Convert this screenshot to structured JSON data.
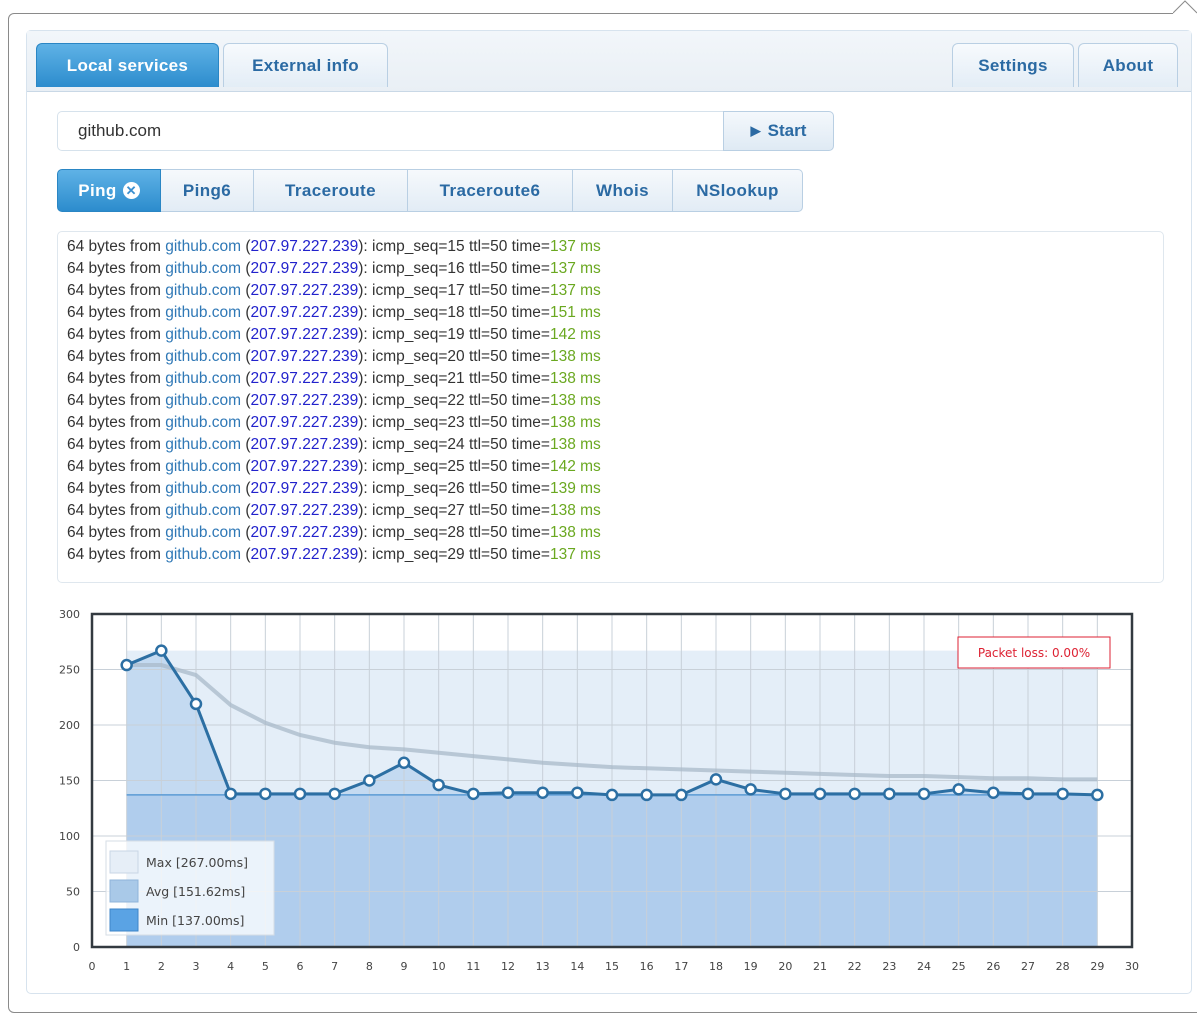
{
  "main_tabs": [
    {
      "label": "Local services",
      "active": true
    },
    {
      "label": "External info",
      "active": false
    }
  ],
  "right_tabs": [
    {
      "label": "Settings"
    },
    {
      "label": "About"
    }
  ],
  "search": {
    "value": "github.com",
    "start_label": "Start"
  },
  "tool_tabs": [
    {
      "label": "Ping",
      "active": true,
      "closable": true
    },
    {
      "label": "Ping6"
    },
    {
      "label": "Traceroute"
    },
    {
      "label": "Traceroute6"
    },
    {
      "label": "Whois"
    },
    {
      "label": "NSlookup"
    }
  ],
  "output": {
    "lines": [
      {
        "prefix": "64 bytes from ",
        "host": "github.com",
        "ip": "207.97.227.239",
        "mid": "): icmp_seq=15 ttl=50 time=",
        "time": "137 ms"
      },
      {
        "prefix": "64 bytes from ",
        "host": "github.com",
        "ip": "207.97.227.239",
        "mid": "): icmp_seq=16 ttl=50 time=",
        "time": "137 ms"
      },
      {
        "prefix": "64 bytes from ",
        "host": "github.com",
        "ip": "207.97.227.239",
        "mid": "): icmp_seq=17 ttl=50 time=",
        "time": "137 ms"
      },
      {
        "prefix": "64 bytes from ",
        "host": "github.com",
        "ip": "207.97.227.239",
        "mid": "): icmp_seq=18 ttl=50 time=",
        "time": "151 ms"
      },
      {
        "prefix": "64 bytes from ",
        "host": "github.com",
        "ip": "207.97.227.239",
        "mid": "): icmp_seq=19 ttl=50 time=",
        "time": "142 ms"
      },
      {
        "prefix": "64 bytes from ",
        "host": "github.com",
        "ip": "207.97.227.239",
        "mid": "): icmp_seq=20 ttl=50 time=",
        "time": "138 ms"
      },
      {
        "prefix": "64 bytes from ",
        "host": "github.com",
        "ip": "207.97.227.239",
        "mid": "): icmp_seq=21 ttl=50 time=",
        "time": "138 ms"
      },
      {
        "prefix": "64 bytes from ",
        "host": "github.com",
        "ip": "207.97.227.239",
        "mid": "): icmp_seq=22 ttl=50 time=",
        "time": "138 ms"
      },
      {
        "prefix": "64 bytes from ",
        "host": "github.com",
        "ip": "207.97.227.239",
        "mid": "): icmp_seq=23 ttl=50 time=",
        "time": "138 ms"
      },
      {
        "prefix": "64 bytes from ",
        "host": "github.com",
        "ip": "207.97.227.239",
        "mid": "): icmp_seq=24 ttl=50 time=",
        "time": "138 ms"
      },
      {
        "prefix": "64 bytes from ",
        "host": "github.com",
        "ip": "207.97.227.239",
        "mid": "): icmp_seq=25 ttl=50 time=",
        "time": "142 ms"
      },
      {
        "prefix": "64 bytes from ",
        "host": "github.com",
        "ip": "207.97.227.239",
        "mid": "): icmp_seq=26 ttl=50 time=",
        "time": "139 ms"
      },
      {
        "prefix": "64 bytes from ",
        "host": "github.com",
        "ip": "207.97.227.239",
        "mid": "): icmp_seq=27 ttl=50 time=",
        "time": "138 ms"
      },
      {
        "prefix": "64 bytes from ",
        "host": "github.com",
        "ip": "207.97.227.239",
        "mid": "): icmp_seq=28 ttl=50 time=",
        "time": "138 ms"
      },
      {
        "prefix": "64 bytes from ",
        "host": "github.com",
        "ip": "207.97.227.239",
        "mid": "): icmp_seq=29 ttl=50 time=",
        "time": "137 ms"
      }
    ]
  },
  "chart_data": {
    "type": "line",
    "x": [
      1,
      2,
      3,
      4,
      5,
      6,
      7,
      8,
      9,
      10,
      11,
      12,
      13,
      14,
      15,
      16,
      17,
      18,
      19,
      20,
      21,
      22,
      23,
      24,
      25,
      26,
      27,
      28,
      29
    ],
    "series": [
      {
        "values": [
          254,
          267,
          219,
          138,
          138,
          138,
          138,
          150,
          166,
          146,
          138,
          139,
          139,
          139,
          137,
          137,
          137,
          151,
          142,
          138,
          138,
          138,
          138,
          138,
          142,
          139,
          138,
          138,
          137
        ]
      },
      {
        "values": [
          254,
          254,
          245,
          218,
          202,
          191,
          184,
          180,
          178,
          175,
          172,
          169,
          166,
          164,
          162,
          161,
          160,
          159,
          158,
          157,
          156,
          155,
          154,
          154,
          153,
          152,
          152,
          151,
          151
        ]
      }
    ],
    "bands": {
      "max": 267.0,
      "min": 137.0
    },
    "xlim": [
      0,
      30
    ],
    "ylim": [
      0,
      300
    ],
    "xticks": [
      0,
      1,
      2,
      3,
      4,
      5,
      6,
      7,
      8,
      9,
      10,
      11,
      12,
      13,
      14,
      15,
      16,
      17,
      18,
      19,
      20,
      21,
      22,
      23,
      24,
      25,
      26,
      27,
      28,
      29,
      30
    ],
    "yticks": [
      0,
      50,
      100,
      150,
      200,
      250,
      300
    ],
    "legend": [
      {
        "label": "Max [267.00ms]"
      },
      {
        "label": "Avg [151.62ms]"
      },
      {
        "label": "Min [137.00ms]"
      }
    ],
    "annotation": "Packet loss: 0.00%",
    "legend_position": "bottom-left",
    "grid": true,
    "colors": {
      "line": "#2c6fa3",
      "avg": "#a9b9c9",
      "min_fill": "#bfd8f0",
      "max_fill": "#e4eef8",
      "annotation": "#dd2233"
    }
  }
}
